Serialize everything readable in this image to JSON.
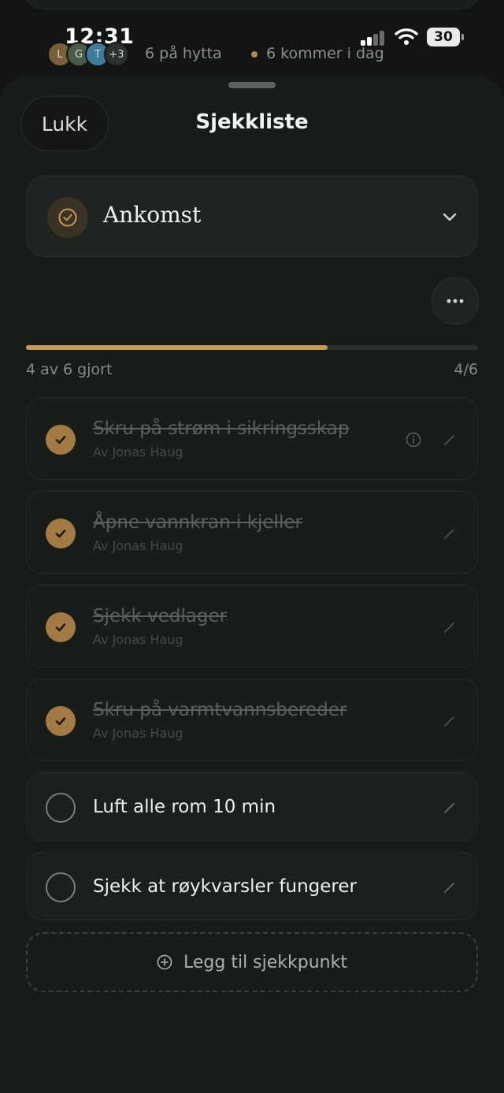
{
  "status_bar": {
    "time": "12:31",
    "battery": "30"
  },
  "presence": {
    "avatars": [
      {
        "initial": "L",
        "color": "#7a6038"
      },
      {
        "initial": "G",
        "color": "#4a5a48"
      },
      {
        "initial": "T",
        "color": "#3f7c9c"
      },
      {
        "initial": "+3",
        "color": "#2c312d"
      }
    ],
    "people_text": "6 på hytta",
    "arrivals_text": "6 kommer i dag"
  },
  "sheet": {
    "close_label": "Lukk",
    "title": "Sjekkliste",
    "section_name": "Ankomst"
  },
  "progress": {
    "done": 4,
    "total": 6,
    "label": "4 av 6 gjort",
    "count": "4/6"
  },
  "items": [
    {
      "title": "Skru på strøm i sikringsskap",
      "author": "Av Jonas Haug",
      "done": true,
      "has_info": true
    },
    {
      "title": "Åpne vannkran i kjeller",
      "author": "Av Jonas Haug",
      "done": true,
      "has_info": false
    },
    {
      "title": "Sjekk vedlager",
      "author": "Av Jonas Haug",
      "done": true,
      "has_info": false
    },
    {
      "title": "Skru på varmtvannsbereder",
      "author": "Av Jonas Haug",
      "done": true,
      "has_info": false
    },
    {
      "title": "Luft alle rom 10 min",
      "author": "",
      "done": false,
      "has_info": false
    },
    {
      "title": "Sjekk at røykvarsler fungerer",
      "author": "",
      "done": false,
      "has_info": false
    }
  ],
  "add_item_label": "Legg til sjekkpunkt",
  "colors": {
    "accent": "#c49a59",
    "check_done": "#a37a44",
    "background": "#121513",
    "sheet": "#181c19"
  }
}
